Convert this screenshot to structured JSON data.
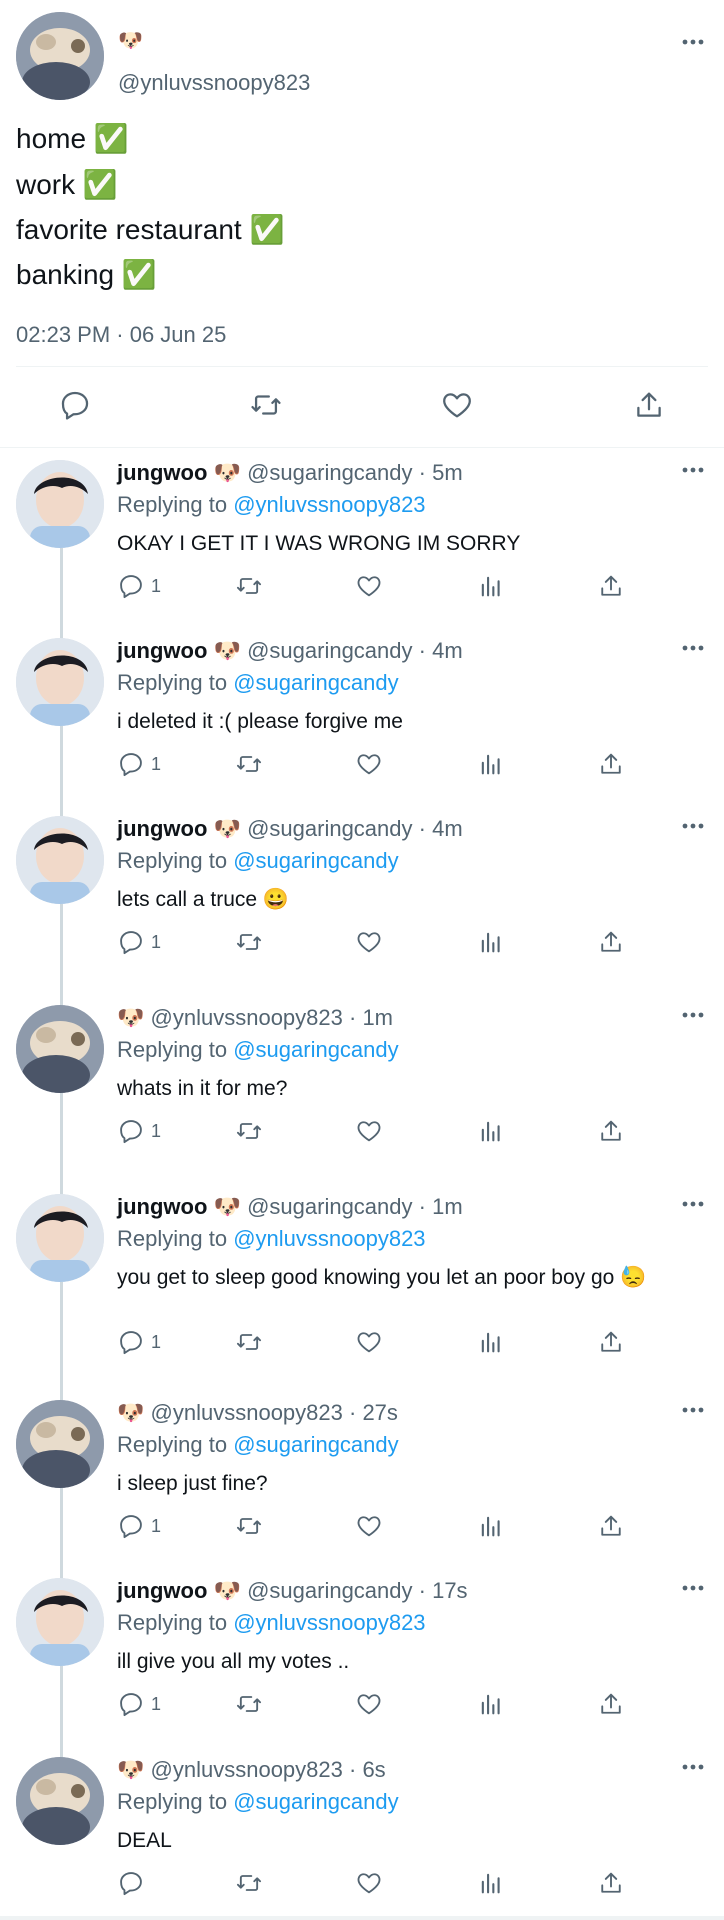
{
  "main_tweet": {
    "display_name_emoji": "🐶",
    "handle": "@ynluvssnoopy823",
    "lines": [
      "home ✅",
      "work ✅",
      "favorite restaurant ✅",
      "banking ✅"
    ],
    "timestamp": "02:23 PM · 06 Jun 25"
  },
  "replies": [
    {
      "name": "jungwoo",
      "emoji": "🐶",
      "handle": "@sugaringcandy",
      "time": "· 5m",
      "replying_label": "Replying to",
      "replying_to": "@ynluvssnoopy823",
      "text": "OKAY I GET IT I WAS WRONG IM SORRY",
      "reply_count": "1",
      "avatar": "jungwoo"
    },
    {
      "name": "jungwoo",
      "emoji": "🐶",
      "handle": "@sugaringcandy",
      "time": "· 4m",
      "replying_label": "Replying to",
      "replying_to": "@sugaringcandy",
      "text": "i deleted it :( please forgive me",
      "reply_count": "1",
      "avatar": "jungwoo"
    },
    {
      "name": "jungwoo",
      "emoji": "🐶",
      "handle": "@sugaringcandy",
      "time": "· 4m",
      "replying_label": "Replying to",
      "replying_to": "@sugaringcandy",
      "text": "lets call a truce 😀",
      "reply_count": "1",
      "avatar": "jungwoo"
    },
    {
      "name": "",
      "emoji": "🐶",
      "handle": "@ynluvssnoopy823",
      "time": "· 1m",
      "replying_label": "Replying to",
      "replying_to": "@sugaringcandy",
      "text": "whats in it for me?",
      "reply_count": "1",
      "avatar": "yn"
    },
    {
      "name": "jungwoo",
      "emoji": "🐶",
      "handle": "@sugaringcandy",
      "time": "· 1m",
      "replying_label": "Replying to",
      "replying_to": "@ynluvssnoopy823",
      "text": "you get to sleep good knowing you let an poor boy go 😓",
      "reply_count": "1",
      "avatar": "jungwoo"
    },
    {
      "name": "",
      "emoji": "🐶",
      "handle": "@ynluvssnoopy823",
      "time": "· 27s",
      "replying_label": "Replying to",
      "replying_to": "@sugaringcandy",
      "text": "i sleep just fine?",
      "reply_count": "1",
      "avatar": "yn"
    },
    {
      "name": "jungwoo",
      "emoji": "🐶",
      "handle": "@sugaringcandy",
      "time": "· 17s",
      "replying_label": "Replying to",
      "replying_to": "@ynluvssnoopy823",
      "text": "ill give you all my votes ..",
      "reply_count": "1",
      "avatar": "jungwoo"
    },
    {
      "name": "",
      "emoji": "🐶",
      "handle": "@ynluvssnoopy823",
      "time": "· 6s",
      "replying_label": "Replying to",
      "replying_to": "@sugaringcandy",
      "text": "DEAL",
      "reply_count": "",
      "avatar": "yn"
    }
  ],
  "icons": {
    "more": "more-horizontal-icon",
    "reply": "reply-icon",
    "retweet": "retweet-icon",
    "like": "heart-icon",
    "views": "views-icon",
    "share": "share-icon"
  },
  "colors": {
    "link": "#1d9bf0",
    "muted": "#536471",
    "text": "#0f1419",
    "divider": "#cfd9de",
    "check": "#2fb344"
  }
}
